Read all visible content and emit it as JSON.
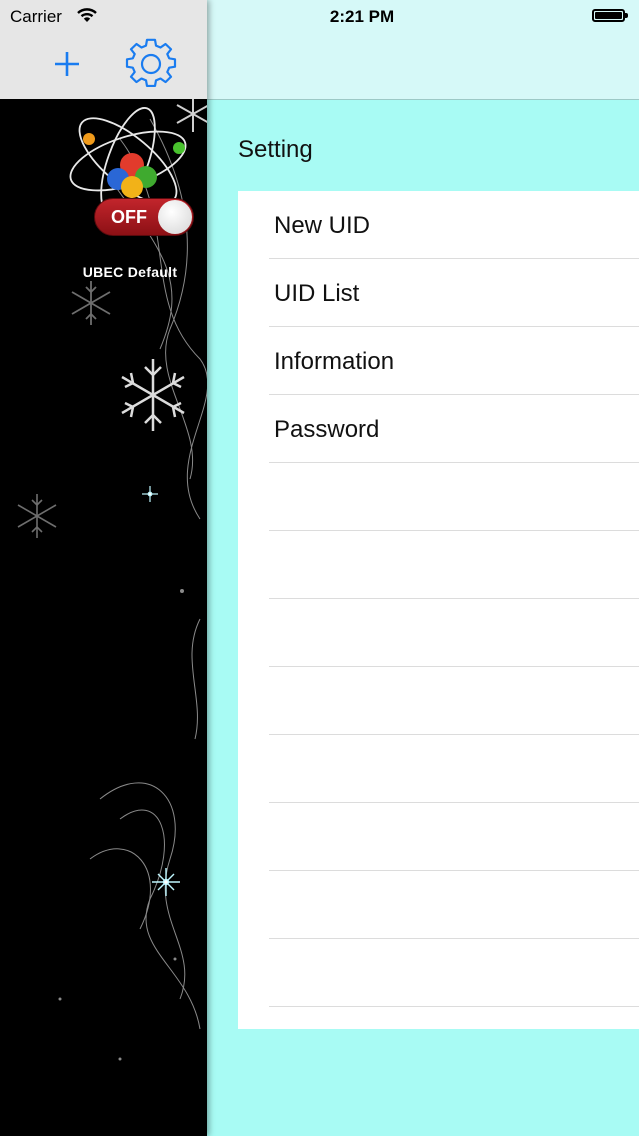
{
  "status_bar": {
    "carrier": "Carrier",
    "time": "2:21 PM",
    "icons": [
      "wifi-icon",
      "battery-icon"
    ]
  },
  "drawer": {
    "toolbar": {
      "add_icon": "plus-icon",
      "settings_icon": "gear-icon"
    },
    "device": {
      "logo_icon": "atom-logo-icon",
      "toggle_state": "OFF",
      "name": "UBEC Default"
    }
  },
  "main": {
    "section_title": "Setting",
    "menu_items": [
      {
        "label": "New UID"
      },
      {
        "label": "UID List"
      },
      {
        "label": "Information"
      },
      {
        "label": "Password"
      }
    ]
  },
  "colors": {
    "accent": "#1a7cf0",
    "main_background": "#a8fbf4",
    "nav_background": "#d6f9f8",
    "drawer_background": "#000000",
    "toggle_off": "#b01c22"
  }
}
